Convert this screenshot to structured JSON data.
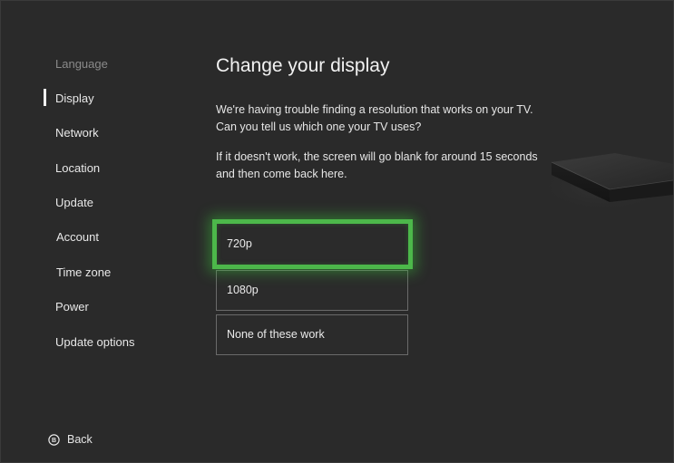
{
  "sidebar": {
    "items": [
      {
        "label": "Language"
      },
      {
        "label": "Display"
      },
      {
        "label": "Network"
      },
      {
        "label": "Location"
      },
      {
        "label": "Update"
      },
      {
        "label": "Account"
      },
      {
        "label": "Time zone"
      },
      {
        "label": "Power"
      },
      {
        "label": "Update options"
      }
    ],
    "selected": "Display"
  },
  "main": {
    "title": "Change your display",
    "paragraph_1": "We're having trouble finding a resolution that works on your TV. Can you tell us which one your TV uses?",
    "paragraph_2": "If it doesn't work, the screen will go blank for around 15 seconds and then come back here.",
    "options": [
      {
        "label": "720p"
      },
      {
        "label": "1080p"
      },
      {
        "label": "None of these work"
      }
    ],
    "focused_option": "720p"
  },
  "footer": {
    "back_label": "Back",
    "back_icon": "b-button-icon"
  },
  "colors": {
    "background": "#2a2a2a",
    "focus": "#4cb84a",
    "text": "#e6e6e6",
    "dim_text": "#8a8a8a"
  }
}
